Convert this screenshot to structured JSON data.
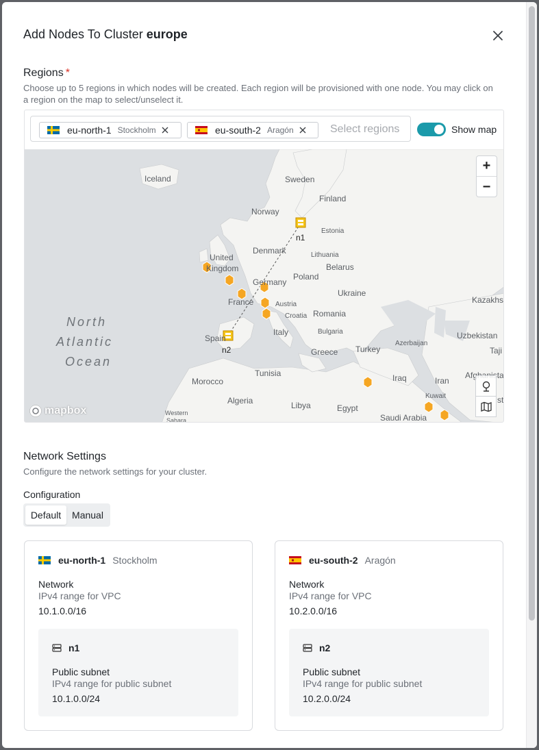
{
  "dialog": {
    "title_prefix": "Add Nodes To Cluster",
    "cluster_name": "europe"
  },
  "regions": {
    "title": "Regions",
    "required_mark": "*",
    "description": "Choose up to 5 regions in which nodes will be created. Each region will be provisioned with one node. You may click on a region on the map to select/unselect it.",
    "selected": [
      {
        "code": "eu-north-1",
        "city": "Stockholm",
        "flag": "sweden"
      },
      {
        "code": "eu-south-2",
        "city": "Aragón",
        "flag": "spain"
      }
    ],
    "placeholder": "Select regions",
    "show_map_label": "Show map",
    "show_map_on": true
  },
  "map": {
    "labels": {
      "iceland": "Iceland",
      "sweden": "Sweden",
      "finland": "Finland",
      "norway": "Norway",
      "estonia": "Estonia",
      "denmark": "Denmark",
      "lithuania": "Lithuania",
      "united": "United",
      "kingdom": "Kingdom",
      "belarus": "Belarus",
      "poland": "Poland",
      "germany": "Germany",
      "ukraine": "Ukraine",
      "france": "France",
      "austria": "Austria",
      "kazakhs": "Kazakhs",
      "croatia": "Croatia",
      "romania": "Romania",
      "north": "North",
      "atlantic": "Atlantic",
      "ocean": "Ocean",
      "uzbekistan": "Uzbekistan",
      "bulgaria": "Bulgaria",
      "spain": "Spain",
      "italy": "Italy",
      "azerbaijan": "Azerbaijan",
      "tajik": "Taji",
      "greece": "Greece",
      "turkey": "Turkey",
      "tunisia": "Tunisia",
      "afghanista": "Afghanista",
      "iraq": "Iraq",
      "iran": "Iran",
      "morocco": "Morocco",
      "kuwait": "Kuwait",
      "algeria": "Algeria",
      "libya": "Libya",
      "egypt": "Egypt",
      "saudi": "Saudi Arabia",
      "western": "Western",
      "sahara": "Sahara",
      "sta": "sta"
    },
    "node_labels": {
      "n1": "n1",
      "n2": "n2"
    },
    "attribution": "mapbox",
    "zoom_in": "+",
    "zoom_out": "−"
  },
  "network": {
    "title": "Network Settings",
    "description": "Configure the network settings for your cluster.",
    "config_label": "Configuration",
    "options": [
      "Default",
      "Manual"
    ],
    "selected_option": "Default",
    "cards": [
      {
        "code": "eu-north-1",
        "city": "Stockholm",
        "network_label": "Network",
        "network_sub": "IPv4 range for VPC",
        "network_value": "10.1.0.0/16",
        "node_name": "n1",
        "subnet_label": "Public subnet",
        "subnet_sub": "IPv4 range for public subnet",
        "subnet_value": "10.1.0.0/24"
      },
      {
        "code": "eu-south-2",
        "city": "Aragón",
        "network_label": "Network",
        "network_sub": "IPv4 range for VPC",
        "network_value": "10.2.0.0/16",
        "node_name": "n2",
        "subnet_label": "Public subnet",
        "subnet_sub": "IPv4 range for public subnet",
        "subnet_value": "10.2.0.0/24"
      }
    ]
  },
  "colors": {
    "accent": "#1b9aaa",
    "marker": "#f5a623",
    "required": "#d93025"
  }
}
